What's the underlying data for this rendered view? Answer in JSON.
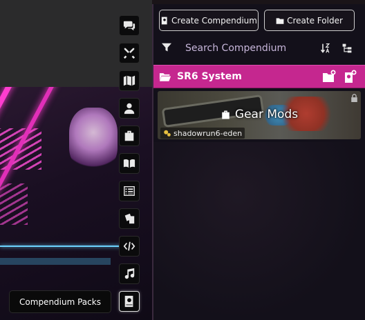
{
  "sidebar_tabs": [
    {
      "name": "chat",
      "icon": "comments-icon"
    },
    {
      "name": "combat",
      "icon": "swords-icon"
    },
    {
      "name": "scenes",
      "icon": "map-icon"
    },
    {
      "name": "actors",
      "icon": "user-icon"
    },
    {
      "name": "items",
      "icon": "suitcase-icon"
    },
    {
      "name": "journal",
      "icon": "book-icon"
    },
    {
      "name": "tables",
      "icon": "list-icon"
    },
    {
      "name": "cards",
      "icon": "cards-icon"
    },
    {
      "name": "macros",
      "icon": "code-icon"
    },
    {
      "name": "playlists",
      "icon": "music-icon"
    },
    {
      "name": "compendium",
      "icon": "atlas-icon",
      "active": true
    }
  ],
  "tooltip": "Compendium Packs",
  "header": {
    "create_compendium": "Create Compendium",
    "create_folder": "Create Folder"
  },
  "search": {
    "placeholder": "Search Compendium Packs"
  },
  "folder": {
    "name": "SR6 System",
    "color": "#c5278f"
  },
  "pack": {
    "title": "Gear Mods",
    "source": "shadowrun6-eden"
  }
}
